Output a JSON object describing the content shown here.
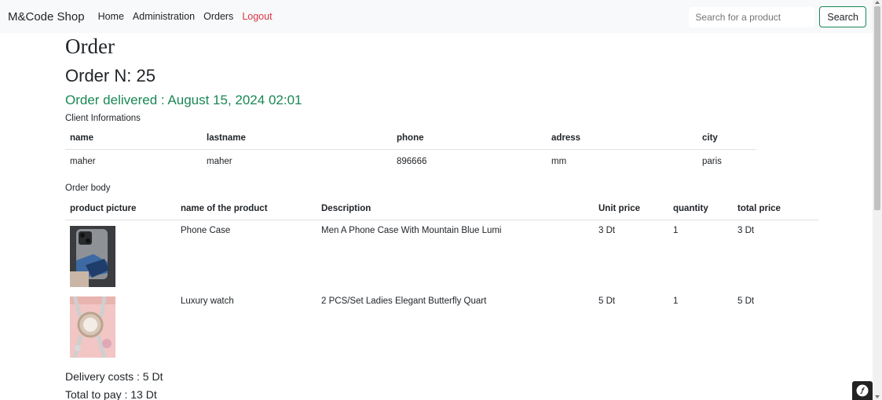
{
  "navbar": {
    "brand": "M&Code Shop",
    "links": [
      "Home",
      "Administration",
      "Orders",
      "Logout"
    ],
    "search_placeholder": "Search for a product",
    "search_button": "Search"
  },
  "page": {
    "title": "Order",
    "order_number": "Order N: 25",
    "delivered": "Order delivered : August 15, 2024 02:01",
    "accent_color": "#198754",
    "logout_color": "#dc3545"
  },
  "client": {
    "section_label": "Client Informations",
    "headers": [
      "name",
      "lastname",
      "phone",
      "adress",
      "city"
    ],
    "values": [
      "maher",
      "maher",
      "896666",
      "mm",
      "paris"
    ]
  },
  "order": {
    "section_label": "Order body",
    "headers": [
      "product picture",
      "name of the product",
      "Description",
      "Unit price",
      "quantity",
      "total price"
    ],
    "rows": [
      {
        "picture_icon": "phone-case-photo",
        "name": "Phone Case",
        "description": "Men A Phone Case With Mountain Blue Lumi",
        "unit_price": "3 Dt",
        "quantity": "1",
        "total_price": "3 Dt"
      },
      {
        "picture_icon": "watch-photo",
        "name": "Luxury watch",
        "description": "2 PCS/Set Ladies Elegant Butterfly Quart",
        "unit_price": "5 Dt",
        "quantity": "1",
        "total_price": "5 Dt"
      }
    ]
  },
  "totals": {
    "delivery": "Delivery costs : 5 Dt",
    "total": "Total to pay : 13 Dt"
  },
  "footer": {
    "badge_icon": "symfony-icon"
  }
}
